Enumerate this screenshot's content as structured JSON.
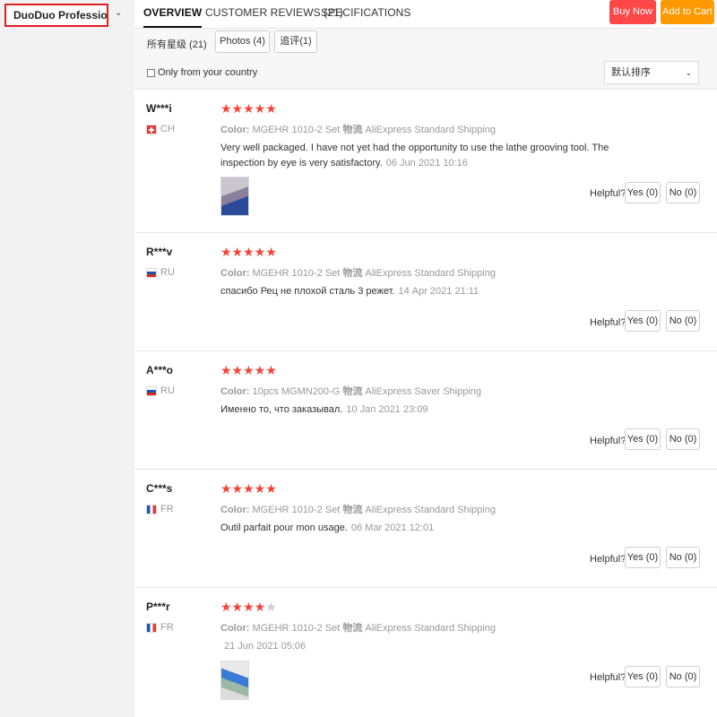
{
  "store": {
    "name": "DuoDuo Profession..."
  },
  "nav": {
    "tabs": [
      "OVERVIEW",
      "CUSTOMER REVIEWS (21)",
      "SPECIFICATIONS"
    ],
    "buy_now": "Buy Now",
    "add_to_cart": "Add to Cart"
  },
  "filters": {
    "stars_filter": "所有星级 (21)",
    "photos": "Photos (4)",
    "followup": "追评(1)",
    "country_label": "Only from your country",
    "sort": "默认排序"
  },
  "labels": {
    "color": "Color:",
    "shipping": "物流",
    "helpful": "Helpful?"
  },
  "colors": {
    "star": "#f44336",
    "buy": "#ff4747",
    "cart": "#ff9900",
    "highlight": "#e02020"
  },
  "reviews": [
    {
      "name": "W***i",
      "country": "CH",
      "stars": 5,
      "color_value": "MGEHR 1010-2 Set",
      "shipping": "AliExpress Standard Shipping",
      "text": "Very well packaged. I have not yet had the opportunity to use the lathe grooving tool. The inspection by eye is very satisfactory.",
      "date": "06 Jun 2021 10:16",
      "yes": "Yes (0)",
      "no": "No (0)",
      "has_photo": true
    },
    {
      "name": "R***v",
      "country": "RU",
      "stars": 5,
      "color_value": "MGEHR 1010-2 Set",
      "shipping": "AliExpress Standard Shipping",
      "text": "спасибо Рец не плохой сталь 3 режет.",
      "date": "14 Apr 2021 21:11",
      "yes": "Yes (0)",
      "no": "No (0)",
      "has_photo": false
    },
    {
      "name": "A***o",
      "country": "RU",
      "stars": 5,
      "color_value": "10pcs MGMN200-G",
      "shipping": "AliExpress Saver Shipping",
      "text": "Именно то, что заказывал.",
      "date": "10 Jan 2021 23:09",
      "yes": "Yes (0)",
      "no": "No (0)",
      "has_photo": false
    },
    {
      "name": "C***s",
      "country": "FR",
      "stars": 5,
      "color_value": "MGEHR 1010-2 Set",
      "shipping": "AliExpress Standard Shipping",
      "text": "Outil parfait pour mon usage.",
      "date": "06 Mar 2021 12:01",
      "yes": "Yes (0)",
      "no": "No (0)",
      "has_photo": false
    },
    {
      "name": "P***r",
      "country": "FR",
      "stars": 4,
      "color_value": "MGEHR 1010-2 Set",
      "shipping": "AliExpress Standard Shipping",
      "text": "",
      "date": "21 Jun 2021 05:06",
      "yes": "Yes (0)",
      "no": "No (0)",
      "has_photo": true
    }
  ]
}
